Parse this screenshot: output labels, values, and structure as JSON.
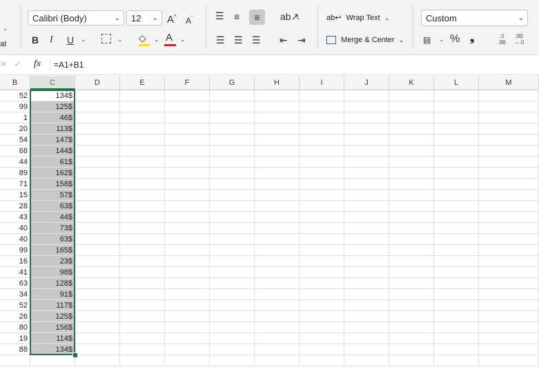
{
  "ribbon": {
    "font_name": "Calibri (Body)",
    "font_size": "12",
    "wrap_text_label": "Wrap Text",
    "merge_center_label": "Merge & Center",
    "number_format": "Custom",
    "bold": "B",
    "italic": "I",
    "underline": "U",
    "grow_font": "A",
    "shrink_font": "A",
    "percent": "%",
    "comma": "❟",
    "format_fragment": "at",
    "dec_increase_top": ".0",
    "dec_increase_bottom": ".00",
    "dec_decrease_top": ".00",
    "dec_decrease_bottom": "→.0",
    "accent_font_color": "#e02020",
    "accent_fill_color": "#f5e400"
  },
  "formula_bar": {
    "fx_label": "fx",
    "formula": "=A1+B1"
  },
  "columns": [
    "B",
    "C",
    "D",
    "E",
    "F",
    "G",
    "H",
    "I",
    "J",
    "K",
    "L",
    "M"
  ],
  "rows": [
    {
      "b": "52",
      "c": "134$"
    },
    {
      "b": "99",
      "c": "125$"
    },
    {
      "b": "1",
      "c": "46$"
    },
    {
      "b": "20",
      "c": "113$"
    },
    {
      "b": "54",
      "c": "147$"
    },
    {
      "b": "68",
      "c": "144$"
    },
    {
      "b": "44",
      "c": "61$"
    },
    {
      "b": "89",
      "c": "162$"
    },
    {
      "b": "71",
      "c": "158$"
    },
    {
      "b": "15",
      "c": "57$"
    },
    {
      "b": "28",
      "c": "63$"
    },
    {
      "b": "43",
      "c": "44$"
    },
    {
      "b": "40",
      "c": "73$"
    },
    {
      "b": "40",
      "c": "63$"
    },
    {
      "b": "99",
      "c": "165$"
    },
    {
      "b": "16",
      "c": "23$"
    },
    {
      "b": "41",
      "c": "98$"
    },
    {
      "b": "63",
      "c": "128$"
    },
    {
      "b": "34",
      "c": "91$"
    },
    {
      "b": "52",
      "c": "117$"
    },
    {
      "b": "26",
      "c": "125$"
    },
    {
      "b": "80",
      "c": "156$"
    },
    {
      "b": "19",
      "c": "114$"
    },
    {
      "b": "88",
      "c": "134$"
    }
  ]
}
